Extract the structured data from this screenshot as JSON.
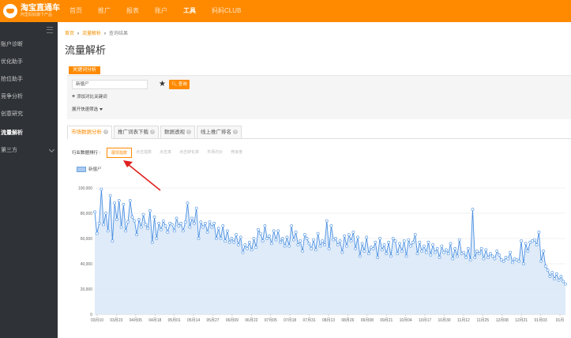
{
  "brand": {
    "name": "淘宝直通车",
    "subtitle": "阿里妈妈旗下产品"
  },
  "nav": [
    {
      "label": "首页",
      "active": false
    },
    {
      "label": "推广",
      "active": false
    },
    {
      "label": "报表",
      "active": false
    },
    {
      "label": "账户",
      "active": false
    },
    {
      "label": "工具",
      "active": true
    },
    {
      "label": "妈妈CLUB",
      "active": false
    }
  ],
  "sidebar": {
    "items": [
      {
        "label": "账户诊断",
        "active": false
      },
      {
        "label": "优化助手",
        "active": false
      },
      {
        "label": "抢位助手",
        "active": false
      },
      {
        "label": "竞争分析",
        "active": false
      },
      {
        "label": "创意研究",
        "active": false
      },
      {
        "label": "流量解析",
        "active": true
      },
      {
        "label": "第三方",
        "active": false,
        "expandable": true
      }
    ]
  },
  "breadcrumb": {
    "home": "首页",
    "parent": "流量解析",
    "current": "查询结果"
  },
  "page_title": "流量解析",
  "keyword_tab": "关键词分析",
  "search": {
    "value": "新僵尸",
    "button": "查询",
    "add_link": "添加对比关键词",
    "expand_link": "展开快速筛选"
  },
  "analysis_tabs": [
    {
      "label": "市场数据分析",
      "active": true
    },
    {
      "label": "推广词表下载",
      "active": false
    },
    {
      "label": "数据透视",
      "active": false
    },
    {
      "label": "线上推广排名",
      "active": false
    }
  ],
  "metric_label": "行业数据排行",
  "metric_tabs": [
    {
      "label": "展现指数",
      "active": true
    },
    {
      "label": "点击指数",
      "active": false
    },
    {
      "label": "点击率",
      "active": false
    },
    {
      "label": "点击转化率",
      "active": false
    },
    {
      "label": "市场均价",
      "active": false
    },
    {
      "label": "竞争度",
      "active": false
    }
  ],
  "chart_data": {
    "type": "area",
    "series": [
      {
        "name": "新僵尸",
        "values": [
          81000,
          64000,
          72000,
          99000,
          71000,
          80000,
          66000,
          94000,
          58000,
          88000,
          75000,
          90000,
          69000,
          87000,
          66000,
          73000,
          90000,
          77000,
          74000,
          63000,
          75000,
          69000,
          79000,
          71000,
          68000,
          82000,
          57000,
          77000,
          60000,
          72000,
          67000,
          74000,
          70000,
          65000,
          72000,
          71000,
          66000,
          76000,
          70000,
          72000,
          66000,
          73000,
          88000,
          69000,
          76000,
          72000,
          84000,
          60000,
          73000,
          69000,
          72000,
          65000,
          73000,
          69000,
          72000,
          60000,
          68000,
          60000,
          70000,
          58000,
          66000,
          57000,
          60000,
          57000,
          63000,
          55000,
          61000,
          49000,
          55000,
          52000,
          57000,
          51000,
          60000,
          53000,
          67000,
          64000,
          58000,
          70000,
          60000,
          62000,
          56000,
          66000,
          59000,
          66000,
          57000,
          60000,
          54000,
          61000,
          54000,
          70000,
          59000,
          65000,
          55000,
          58000,
          50000,
          63000,
          60000,
          56000,
          52000,
          59000,
          51000,
          64000,
          54000,
          58000,
          55000,
          74000,
          52000,
          70000,
          59000,
          60000,
          55000,
          58000,
          49000,
          62000,
          54000,
          63000,
          58000,
          65000,
          52000,
          61000,
          46000,
          56000,
          50000,
          61000,
          48000,
          53000,
          52000,
          57000,
          45000,
          60000,
          51000,
          55000,
          48000,
          57000,
          46000,
          60000,
          58000,
          48000,
          56000,
          50000,
          58000,
          46000,
          59000,
          54000,
          57000,
          63000,
          48000,
          57000,
          50000,
          54000,
          49000,
          57000,
          47000,
          55000,
          49000,
          52000,
          45000,
          54000,
          49000,
          51000,
          48000,
          56000,
          44000,
          52000,
          46000,
          59000,
          48000,
          49000,
          45000,
          52000,
          43000,
          83000,
          45000,
          50000,
          48000,
          52000,
          44000,
          51000,
          45000,
          48000,
          46000,
          44000,
          50000,
          47000,
          43000,
          42000,
          45000,
          44000,
          49000,
          41000,
          44000,
          43000,
          42000,
          58000,
          40000,
          56000,
          50000,
          57000,
          58000,
          59000,
          55000,
          65000,
          42000,
          50000,
          38000,
          35000,
          30000,
          33000,
          28000,
          32000,
          27000,
          30000,
          26000,
          24000
        ]
      }
    ],
    "x_tick_labels": [
      "03月10",
      "03月23",
      "04月05",
      "04月18",
      "05月01",
      "05月14",
      "05月27",
      "06月09",
      "06月22",
      "07月05",
      "07月18",
      "07月31",
      "08月13",
      "08月26",
      "09月08",
      "09月21",
      "10月04",
      "10月17",
      "10月30",
      "11月12",
      "11月25",
      "12月08",
      "12月21",
      "01月03",
      "01月"
    ],
    "y_tick_labels": [
      "0",
      "20,000",
      "40,000",
      "60,000",
      "80,000",
      "100,000"
    ],
    "ylim": [
      0,
      100000
    ],
    "grid": true,
    "legend": "top-left",
    "colors": {
      "line": "#4a90e2",
      "fill": "#dce9f8",
      "marker_fill": "#ffffff"
    }
  },
  "colors": {
    "accent": "#ff8a00",
    "sidebar": "#2f3237",
    "annotation_arrow": "#e02020"
  }
}
